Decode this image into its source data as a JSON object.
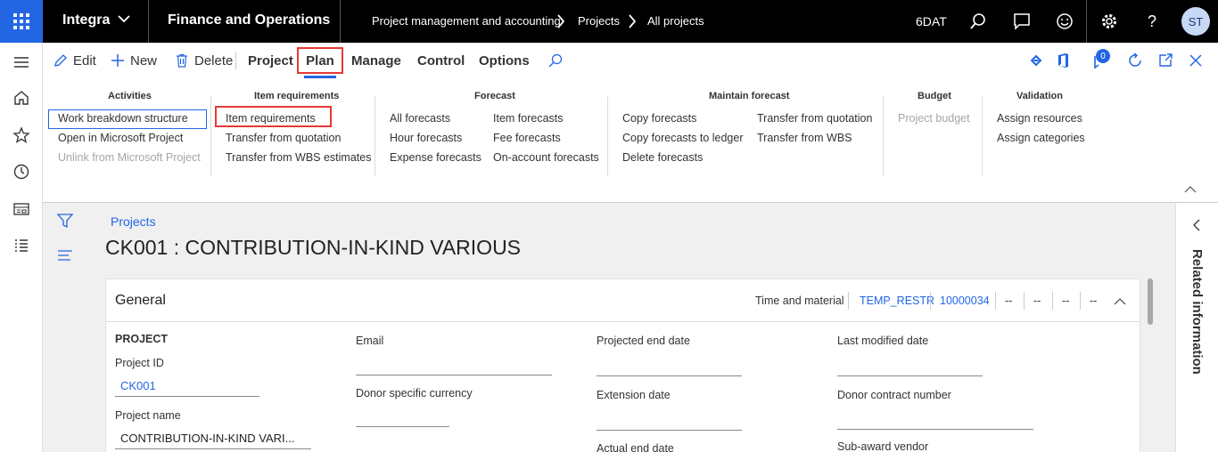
{
  "topbar": {
    "company": "Integra",
    "app_name": "Finance and Operations",
    "breadcrumb": [
      "Project management and accounting",
      "Projects",
      "All projects"
    ],
    "legal_entity": "6DAT",
    "user_initials": "ST"
  },
  "action_pane": {
    "edit": "Edit",
    "new": "New",
    "delete": "Delete",
    "tabs": [
      "Project",
      "Plan",
      "Manage",
      "Control",
      "Options"
    ],
    "badge": "0"
  },
  "ribbon": {
    "activities": {
      "title": "Activities",
      "items": [
        "Work breakdown structure",
        "Open in Microsoft Project",
        "Unlink from Microsoft Project"
      ]
    },
    "item_requirements": {
      "title": "Item requirements",
      "items": [
        "Item requirements",
        "Transfer from quotation",
        "Transfer from WBS estimates"
      ]
    },
    "forecast": {
      "title": "Forecast",
      "col1": [
        "All forecasts",
        "Hour forecasts",
        "Expense forecasts"
      ],
      "col2": [
        "Item forecasts",
        "Fee forecasts",
        "On-account forecasts"
      ]
    },
    "maintain_forecast": {
      "title": "Maintain forecast",
      "col1": [
        "Copy forecasts",
        "Copy forecasts to ledger",
        "Delete forecasts"
      ],
      "col2": [
        "Transfer from quotation",
        "Transfer from WBS"
      ]
    },
    "budget": {
      "title": "Budget",
      "items": [
        "Project budget"
      ]
    },
    "validation": {
      "title": "Validation",
      "items": [
        "Assign resources",
        "Assign categories"
      ]
    }
  },
  "page": {
    "breadcrumb_link": "Projects",
    "title": "CK001 : CONTRIBUTION-IN-KIND VARIOUS"
  },
  "related_info": "Related information",
  "general": {
    "title": "General",
    "summary": [
      "Time and material",
      "TEMP_RESTR",
      "10000034",
      "--",
      "--",
      "--",
      "--"
    ],
    "section_label": "PROJECT",
    "project_id_label": "Project ID",
    "project_id": "CK001",
    "project_name_label": "Project name",
    "project_name": "CONTRIBUTION-IN-KIND  VARI...",
    "email_label": "Email",
    "donor_currency_label": "Donor specific currency",
    "projected_end_label": "Projected end date",
    "extension_label": "Extension date",
    "actual_end_label": "Actual end date",
    "last_modified_label": "Last modified date",
    "donor_contract_label": "Donor contract number",
    "subaward_label": "Sub-award vendor"
  },
  "colors": {
    "accent": "#2266e3",
    "link": "#2266e3",
    "highlight": "#e53935",
    "topbar": "#000000"
  }
}
